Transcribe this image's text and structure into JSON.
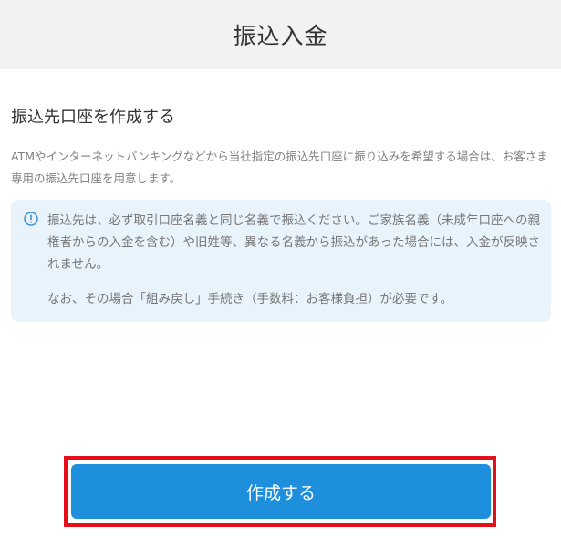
{
  "header": {
    "title": "振込入金"
  },
  "section": {
    "title": "振込先口座を作成する",
    "description": "ATMやインターネットバンキングなどから当社指定の振込先口座に振り込みを希望する場合は、お客さま専用の振込先口座を用意します。"
  },
  "notice": {
    "icon": "info-circle-icon",
    "text": "振込先は、必ず取引口座名義と同じ名義で振込ください。ご家族名義（未成年口座への親権者からの入金を含む）や旧姓等、異なる名義から振込があった場合には、入金が反映されません。",
    "note": "なお、その場合「組み戻し」手続き（手数料：お客様負担）が必要です。"
  },
  "actions": {
    "create_label": "作成する"
  },
  "colors": {
    "header_bg": "#f2f2f2",
    "notice_bg": "#e8f3fc",
    "accent": "#1e8fdc",
    "highlight": "#e3101c"
  }
}
